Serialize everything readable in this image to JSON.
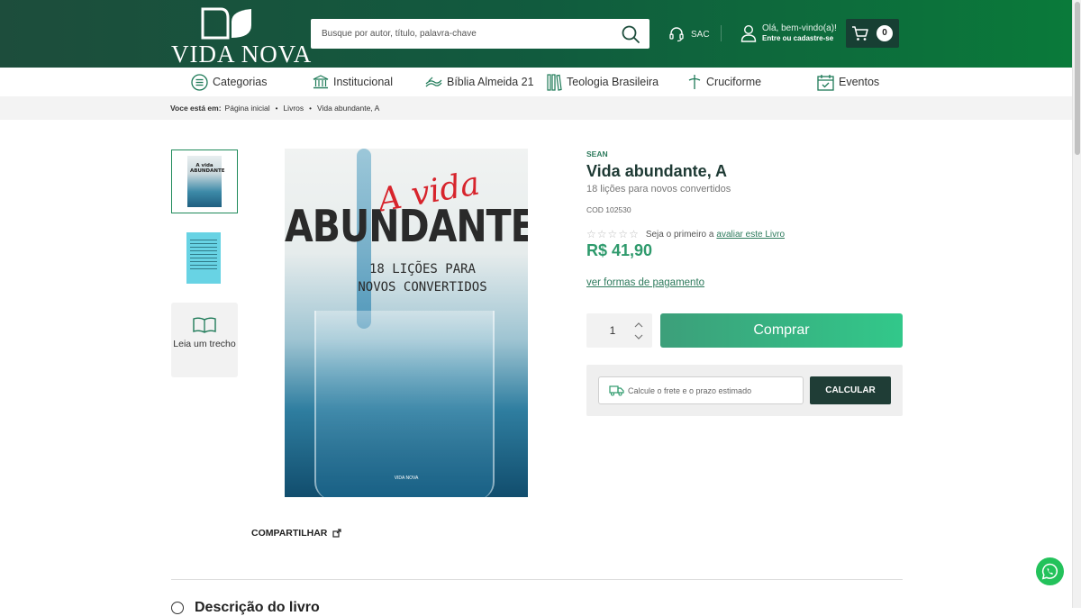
{
  "header": {
    "logo_text": "VIDA NOVA",
    "search_placeholder": "Busque por autor, título, palavra-chave",
    "sac_label": "SAC",
    "account_greeting": "Olá, bem-vindo(a)!",
    "account_action": "Entre ou cadastre-se",
    "cart_count": "0"
  },
  "nav": {
    "items": [
      {
        "label": "Categorias",
        "icon": "menu-icon"
      },
      {
        "label": "Institucional",
        "icon": "building-icon"
      },
      {
        "label": "Bíblia Almeida 21",
        "icon": "bible-icon"
      },
      {
        "label": "Teologia Brasileira",
        "icon": "books-icon"
      },
      {
        "label": "Cruciforme",
        "icon": "cross-icon"
      },
      {
        "label": "Eventos",
        "icon": "calendar-icon"
      }
    ]
  },
  "breadcrumb": {
    "prefix": "Voce está em:",
    "items": [
      "Página inicial",
      "Livros",
      "Vida abundante, A"
    ]
  },
  "gallery": {
    "thumb1_text": "A vida ABUNDANTE",
    "read_excerpt_label": "Leia um trecho"
  },
  "cover": {
    "script_text": "A vida",
    "title_text": "ABUNDANTE",
    "sub_line1": "18 LIÇÕES PARA",
    "sub_line2": "NOVOS CONVERTIDOS",
    "publisher": "VIDA NOVA"
  },
  "share_label": "COMPARTILHAR",
  "product": {
    "author": "SEAN",
    "title": "Vida abundante, A",
    "subtitle": "18 lições para novos convertidos",
    "code": "COD 102530",
    "rating_prefix": "Seja o primeiro a",
    "rating_link": "avaliar este Livro",
    "rating_stars": 0,
    "price": "R$ 41,90",
    "payment_link": "ver formas de pagamento",
    "quantity": "1",
    "buy_label": "Comprar",
    "shipping_placeholder": "Calcule o frete e o prazo estimado",
    "calculate_label": "CALCULAR"
  },
  "description_heading": "Descrição do livro",
  "colors": {
    "header_dark": "#1d4d3c",
    "header_bright": "#0a7a3a",
    "accent_green": "#2e9a6c",
    "buy_button": "#32c88a",
    "calc_button": "#1f3d36",
    "whatsapp": "#23c25b"
  }
}
